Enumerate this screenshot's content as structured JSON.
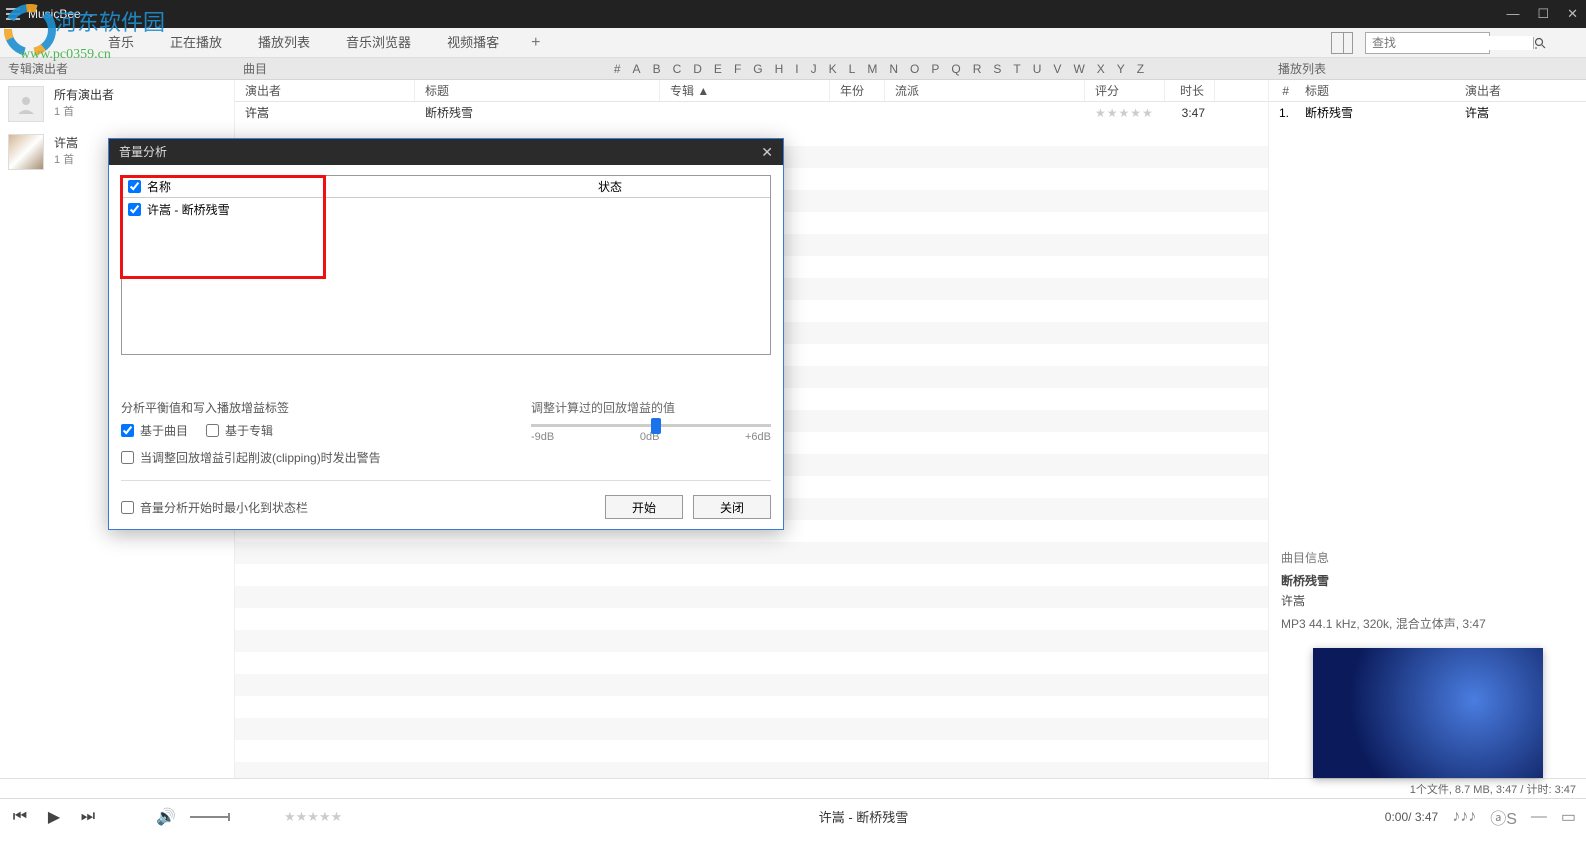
{
  "app": {
    "title": "MusicBee"
  },
  "menu": {
    "music": "音乐",
    "now_playing": "正在播放",
    "playlists": "播放列表",
    "browser": "音乐浏览器",
    "podcast": "视频播客",
    "search_placeholder": "查找"
  },
  "subhead": {
    "album_artist": "专辑演出者",
    "track": "曲目",
    "playlist": "播放列表",
    "letters": [
      "#",
      "A",
      "B",
      "C",
      "D",
      "E",
      "F",
      "G",
      "H",
      "I",
      "J",
      "K",
      "L",
      "M",
      "N",
      "O",
      "P",
      "Q",
      "R",
      "S",
      "T",
      "U",
      "V",
      "W",
      "X",
      "Y",
      "Z"
    ]
  },
  "cols": {
    "artist": "演出者",
    "title": "标题",
    "album": "专辑 ▲",
    "year": "年份",
    "genre": "流派",
    "rating": "评分",
    "duration": "时长"
  },
  "sidebar": {
    "all": {
      "name": "所有演出者",
      "count": "1 首"
    },
    "a1": {
      "name": "许嵩",
      "count": "1 首"
    }
  },
  "track": {
    "artist": "许嵩",
    "title": "断桥残雪",
    "duration": "3:47",
    "stars": "★★★★★"
  },
  "playlist": {
    "num": "#",
    "title": "标题",
    "artist": "演出者",
    "row_num": "1.",
    "row_title": "断桥残雪",
    "row_artist": "许嵩"
  },
  "track_info": {
    "head": "曲目信息",
    "title": "断桥残雪",
    "artist": "许嵩",
    "meta": "MP3 44.1 kHz, 320k, 混合立体声, 3:47"
  },
  "status": "1个文件, 8.7 MB, 3:47 /   计时: 3:47",
  "player": {
    "now_playing": "许嵩 - 断桥残雪",
    "time": "0:00/ 3:47",
    "stars": "★★★★★"
  },
  "modal": {
    "title": "音量分析",
    "col_name": "名称",
    "col_status": "状态",
    "item1": "许嵩 - 断桥残雪",
    "opt_label": "分析平衡值和写入播放增益标签",
    "by_track": "基于曲目",
    "by_album": "基于专辑",
    "slider_label": "调整计算过的回放增益的值",
    "s_m9": "-9dB",
    "s_0": "0dB",
    "s_p6": "+6dB",
    "clip_warn": "当调整回放增益引起削波(clipping)时发出警告",
    "minimize": "音量分析开始时最小化到状态栏",
    "start": "开始",
    "close": "关闭"
  },
  "watermark": {
    "line1": "河东软件园",
    "line2": "www.pc0359.cn"
  }
}
